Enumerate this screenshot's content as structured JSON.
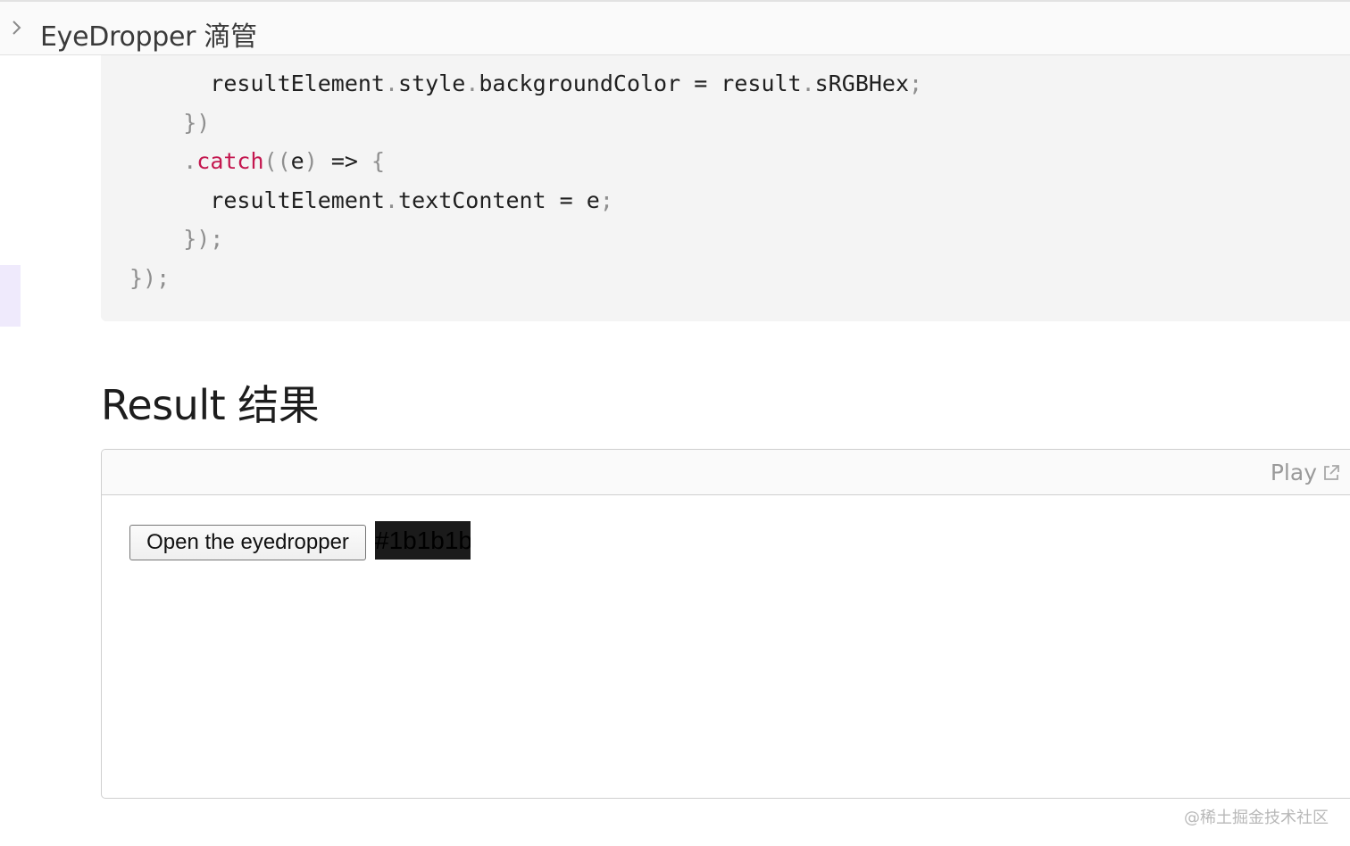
{
  "header": {
    "title": "EyeDropper 滴管",
    "toggle_icon": "chevron-right-icon"
  },
  "code": {
    "lines": [
      [
        {
          "t": "      resultElement",
          "c": ""
        },
        {
          "t": ".",
          "c": "punc"
        },
        {
          "t": "style",
          "c": ""
        },
        {
          "t": ".",
          "c": "punc"
        },
        {
          "t": "backgroundColor = result",
          "c": ""
        },
        {
          "t": ".",
          "c": "punc"
        },
        {
          "t": "sRGBHex",
          "c": ""
        },
        {
          "t": ";",
          "c": "punc"
        }
      ],
      [
        {
          "t": "    })",
          "c": "punc"
        }
      ],
      [
        {
          "t": "    .",
          "c": "punc"
        },
        {
          "t": "catch",
          "c": "kw"
        },
        {
          "t": "((",
          "c": "punc"
        },
        {
          "t": "e",
          "c": ""
        },
        {
          "t": ")",
          "c": "punc"
        },
        {
          "t": " => ",
          "c": ""
        },
        {
          "t": "{",
          "c": "punc"
        }
      ],
      [
        {
          "t": "      resultElement",
          "c": ""
        },
        {
          "t": ".",
          "c": "punc"
        },
        {
          "t": "textContent = e",
          "c": ""
        },
        {
          "t": ";",
          "c": "punc"
        }
      ],
      [
        {
          "t": "    });",
          "c": "punc"
        }
      ],
      [
        {
          "t": "});",
          "c": "punc"
        }
      ]
    ]
  },
  "result": {
    "heading": "Result 结果",
    "play_label": "Play",
    "play_icon": "external-link-icon",
    "open_button_label": "Open the eyedropper",
    "picked_color_text": "#1b1b1b",
    "picked_color": "#1b1b1b"
  },
  "watermark": "@稀土掘金技术社区",
  "colors": {
    "keyword": "#c4174f",
    "punctuation": "#8f8f8f",
    "code_background": "#f4f4f4",
    "accent": "#efeafc"
  }
}
